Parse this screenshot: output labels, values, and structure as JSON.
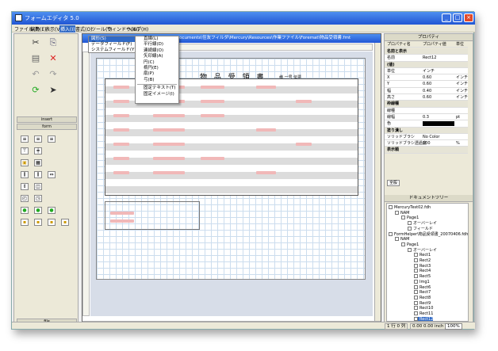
{
  "window": {
    "title": "フォームエディタ 5.0"
  },
  "menu": [
    "ファイル(F)",
    "編集(E)",
    "表示(V)",
    "挿入(I)",
    "書式(O)",
    "ツール(T)",
    "ウィンドウ(W)",
    "ヘルプ(H)"
  ],
  "document": {
    "title": "D:\\Documents\\住友フィルダ\\Mercury\\Resources\\作業ファイル\\Foremat\\物品受領書.fmt",
    "form_title": "物 品 受 領 書",
    "form_subtitle": "様  一号 伝票"
  },
  "insert_menu": [
    "図形(S)",
    "データフィールド(F)",
    "システムフィールド(Y)"
  ],
  "shape_menu": [
    "直線(L)",
    "平行線(D)",
    "連続線(O)",
    "矢印線(A)",
    "円(C)",
    "楕円(E)",
    "扇(P)",
    "弓(B)",
    "固定テキスト(T)",
    "固定イメージ(I)"
  ],
  "left_panel": {
    "section_insert": "insert",
    "section_form": "form",
    "footer": "file"
  },
  "properties": {
    "header": "プロパティ",
    "columns": [
      "プロパティ名",
      "プロパティ値",
      "単位"
    ],
    "rows": [
      {
        "name": "名前と表示",
        "value": "",
        "unit": "",
        "cat": true
      },
      {
        "name": "名前",
        "value": "Rect12",
        "unit": ""
      },
      {
        "name": "(値)",
        "value": "",
        "unit": "",
        "cat": true
      },
      {
        "name": "単位",
        "value": "インチ",
        "unit": ""
      },
      {
        "name": "X",
        "value": "0.60",
        "unit": "インチ"
      },
      {
        "name": "Y",
        "value": "0.60",
        "unit": "インチ"
      },
      {
        "name": "幅",
        "value": "0.40",
        "unit": "インチ"
      },
      {
        "name": "高さ",
        "value": "0.60",
        "unit": "インチ"
      },
      {
        "name": "枠線種",
        "value": "",
        "unit": "",
        "cat": true
      },
      {
        "name": "線種",
        "value": "",
        "unit": ""
      },
      {
        "name": "線幅",
        "value": "0.3",
        "unit": "pt"
      },
      {
        "name": "色",
        "value": "",
        "unit": "",
        "swatch": true
      },
      {
        "name": "塗り潰し",
        "value": "",
        "unit": "",
        "cat": true
      },
      {
        "name": "ソリッドブラシ",
        "value": "No Color",
        "unit": ""
      },
      {
        "name": "ソリッドブラシ透過度",
        "value": "100",
        "unit": "%"
      },
      {
        "name": "表示順",
        "value": "",
        "unit": "",
        "cat": true
      }
    ],
    "tab": "全般"
  },
  "doc_tree": {
    "header": "ドキュメントツリー",
    "items": [
      {
        "label": "MercuryTest02.fdh",
        "indent": 0
      },
      {
        "label": "NAM",
        "indent": 1
      },
      {
        "label": "Page1",
        "indent": 2
      },
      {
        "label": "オーバーレイ",
        "indent": 3
      },
      {
        "label": "フィールド",
        "indent": 3
      },
      {
        "label": "FormHelper\\物品受領書_20070406.fdh",
        "indent": 0
      },
      {
        "label": "NAM",
        "indent": 1
      },
      {
        "label": "Page1",
        "indent": 2
      },
      {
        "label": "オーバーレイ",
        "indent": 3
      },
      {
        "label": "Rect1",
        "indent": 4
      },
      {
        "label": "Rect2",
        "indent": 4
      },
      {
        "label": "Rect3",
        "indent": 4
      },
      {
        "label": "Rect4",
        "indent": 4
      },
      {
        "label": "Rect5",
        "indent": 4
      },
      {
        "label": "Img1",
        "indent": 4
      },
      {
        "label": "Rect6",
        "indent": 4
      },
      {
        "label": "Rect7",
        "indent": 4
      },
      {
        "label": "Rect8",
        "indent": 4
      },
      {
        "label": "Rect9",
        "indent": 4
      },
      {
        "label": "Rect10",
        "indent": 4
      },
      {
        "label": "Rect11",
        "indent": 4
      },
      {
        "label": "Rect12",
        "indent": 4,
        "selected": true
      }
    ]
  },
  "status": {
    "pos": "1 行 0 列",
    "coords": "0.00  0.00 inch",
    "zoom": "100%"
  }
}
